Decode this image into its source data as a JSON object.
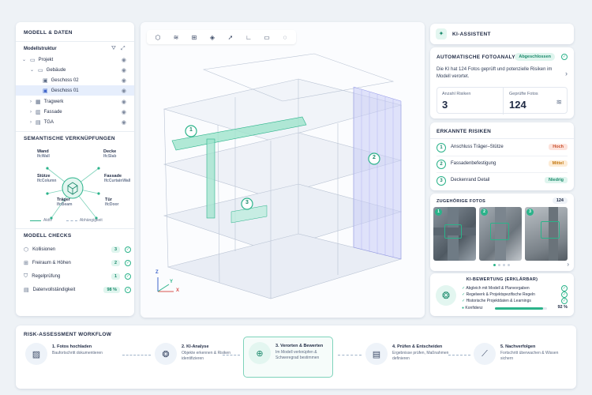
{
  "left": {
    "title": "MODELL & DATEN",
    "struct_label": "Modellstruktur",
    "tree": [
      {
        "label": "Projekt"
      },
      {
        "label": "Gebäude"
      },
      {
        "label": "Geschoss 02"
      },
      {
        "label": "Geschoss 01"
      },
      {
        "label": "Tragwerk"
      },
      {
        "label": "Fassade"
      },
      {
        "label": "TGA"
      }
    ],
    "semantic_title": "SEMANTISCHE VERKNÜPFUNGEN",
    "nodes": [
      {
        "name": "Wand",
        "ifc": "IfcWall"
      },
      {
        "name": "Decke",
        "ifc": "IfcSlab"
      },
      {
        "name": "Stütze",
        "ifc": "IfcColumn"
      },
      {
        "name": "Fassade",
        "ifc": "IfcCurtainWall"
      },
      {
        "name": "Träger",
        "ifc": "IfcBeam"
      },
      {
        "name": "Tür",
        "ifc": "IfcDoor"
      }
    ],
    "legend_active": "Aktiv",
    "legend_dep": "Abhängigkeit",
    "checks_title": "MODELL CHECKS",
    "checks": [
      {
        "label": "Kollisionen",
        "value": "3"
      },
      {
        "label": "Freiraum & Höhen",
        "value": "2"
      },
      {
        "label": "Regelprüfung",
        "value": "1"
      },
      {
        "label": "Datenvollständigkeit",
        "value": "98 %"
      }
    ]
  },
  "viewport": {
    "markers": [
      "1",
      "2",
      "3"
    ],
    "axes": {
      "x": "X",
      "y": "Y",
      "z": "Z"
    }
  },
  "right": {
    "title": "KI-ASSISTENT",
    "analysis_title": "AUTOMATISCHE FOTOANALYSE",
    "analysis_status": "Abgeschlossen",
    "analysis_text": "Die KI hat 124 Fotos geprüft und potenzielle Risiken im Modell verortet.",
    "risk_count_label": "Anzahl Risiken",
    "risk_count": "3",
    "photos_count_label": "Geprüfte Fotos",
    "photos_count": "124",
    "risks_title": "ERKANNTE RISIKEN",
    "risks": [
      {
        "n": "1",
        "label": "Anschluss Träger–Stütze",
        "level": "Hoch",
        "color": "#fde3dc",
        "text": "#c8502e"
      },
      {
        "n": "2",
        "label": "Fassadenbefestigung",
        "level": "Mittel",
        "color": "#fdecd6",
        "text": "#c57a14"
      },
      {
        "n": "3",
        "label": "Deckenrand Detail",
        "level": "Niedrig",
        "color": "#dff5ee",
        "text": "#1c8a6c"
      }
    ],
    "photos_title": "ZUGEHÖRIGE FOTOS",
    "photos_total": "124",
    "photo_tags": [
      "1",
      "2",
      "3"
    ],
    "kibew_title": "KI-BEWERTUNG (ERKLÄRBAR)",
    "kibew_items": [
      "Abgleich mit Modell & Planvorgaben",
      "Regelwerk & Projektspezifische Regeln",
      "Historische Projektdaten & Learnings"
    ],
    "confidence_label": "Konfidenz",
    "confidence": "92 %",
    "confidence_value": 0.92
  },
  "workflow": {
    "title": "RISK-ASSESSMENT WORKFLOW",
    "steps": [
      {
        "title": "1. Fotos hochladen",
        "desc": "Baufortschritt dokumentieren"
      },
      {
        "title": "2. KI-Analyse",
        "desc": "Objekte erkennen & Risiken identifizieren"
      },
      {
        "title": "3. Verorten & Bewerten",
        "desc": "Im Modell verknüpfen & Schweregrad bestimmen"
      },
      {
        "title": "4. Prüfen & Entscheiden",
        "desc": "Ergebnisse prüfen, Maßnahmen definieren"
      },
      {
        "title": "5. Nachverfolgen",
        "desc": "Fortschritt überwachen & Wissen sichern"
      }
    ]
  },
  "colors": {
    "accent": "#2bb38a",
    "primary": "#1f2a44"
  }
}
